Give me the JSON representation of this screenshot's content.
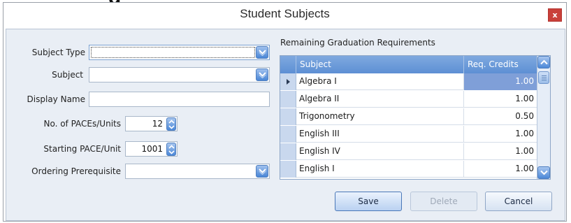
{
  "background_fragment": "g",
  "window": {
    "title": "Student Subjects",
    "close_label": "x"
  },
  "form": {
    "subject_type_label": "Subject Type",
    "subject_type_value": "",
    "subject_label": "Subject",
    "subject_value": "",
    "display_name_label": "Display Name",
    "display_name_value": "",
    "paces_label": "No. of PACEs/Units",
    "paces_value": "12",
    "starting_pace_label": "Starting PACE/Unit",
    "starting_pace_value": "1001",
    "prereq_label": "Ordering Prerequisite",
    "prereq_value": ""
  },
  "requirements": {
    "title": "Remaining Graduation Requirements",
    "columns": [
      "Subject",
      "Req. Credits"
    ],
    "rows": [
      {
        "subject": "Algebra I",
        "credits": "1.00"
      },
      {
        "subject": "Algebra II",
        "credits": "1.00"
      },
      {
        "subject": "Trigonometry",
        "credits": "0.50"
      },
      {
        "subject": "English III",
        "credits": "1.00"
      },
      {
        "subject": "English IV",
        "credits": "1.00"
      },
      {
        "subject": "English I",
        "credits": "1.00"
      }
    ]
  },
  "buttons": {
    "save": "Save",
    "delete": "Delete",
    "cancel": "Cancel"
  },
  "colors": {
    "accent": "#5d8fd4",
    "selected_cell": "#7f9fd8",
    "close_button": "#c9403a",
    "client_bg": "#e9eef5"
  },
  "icons": {
    "dropdown": "chevron-down-icon",
    "spinner": "up-down-spinner-icon",
    "scroll_up": "chevron-up-icon",
    "scroll_down": "chevron-down-icon",
    "row_indicator": "current-row-arrow-icon"
  }
}
